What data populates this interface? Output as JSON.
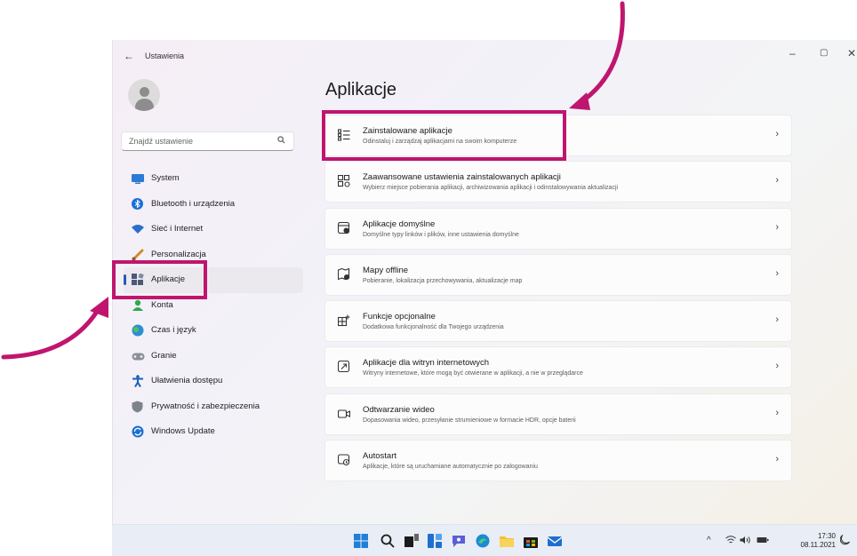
{
  "window": {
    "title": "Ustawienia",
    "back_glyph": "←",
    "controls": [
      "–",
      "▢",
      "✕"
    ]
  },
  "search": {
    "placeholder": "Znajdź ustawienie",
    "icon": "search-icon"
  },
  "sidebar": {
    "items": [
      {
        "label": "System",
        "icon": "display-icon",
        "color": "#2b7bd4"
      },
      {
        "label": "Bluetooth i urządzenia",
        "icon": "bluetooth-icon",
        "color": "#1a6fd6"
      },
      {
        "label": "Sieć i Internet",
        "icon": "wifi-icon",
        "color": "#2a6fc9"
      },
      {
        "label": "Personalizacja",
        "icon": "brush-icon",
        "color": "#d08a2e"
      },
      {
        "label": "Aplikacje",
        "icon": "apps-icon",
        "color": "#4a5a78",
        "active": true
      },
      {
        "label": "Konta",
        "icon": "account-icon",
        "color": "#2fa84f"
      },
      {
        "label": "Czas i język",
        "icon": "globe-clock-icon",
        "color": "#2a8fd4"
      },
      {
        "label": "Granie",
        "icon": "gamepad-icon",
        "color": "#8a8f98"
      },
      {
        "label": "Ułatwienia dostępu",
        "icon": "accessibility-icon",
        "color": "#1b5fb8"
      },
      {
        "label": "Prywatność i zabezpieczenia",
        "icon": "shield-icon",
        "color": "#7d828b"
      },
      {
        "label": "Windows Update",
        "icon": "update-icon",
        "color": "#1f6fd0"
      }
    ]
  },
  "main": {
    "title": "Aplikacje",
    "cards": [
      {
        "title": "Zainstalowane aplikacje",
        "desc": "Odinstaluj i zarządzaj aplikacjami na swoim komputerze",
        "icon": "list-icon"
      },
      {
        "title": "Zaawansowane ustawienia zainstalowanych aplikacji",
        "desc": "Wybierz miejsce pobierania aplikacji, archiwizowania aplikacji i odinstalowywania aktualizacji",
        "icon": "apps-settings-icon"
      },
      {
        "title": "Aplikacje domyślne",
        "desc": "Domyślne typy linków i plików, inne ustawienia domyślne",
        "icon": "default-apps-icon"
      },
      {
        "title": "Mapy offline",
        "desc": "Pobieranie, lokalizacja przechowywania, aktualizacje map",
        "icon": "map-icon"
      },
      {
        "title": "Funkcje opcjonalne",
        "desc": "Dodatkowa funkcjonalność dla Twojego urządzenia",
        "icon": "optional-features-icon"
      },
      {
        "title": "Aplikacje dla witryn internetowych",
        "desc": "Witryny internetowe, które mogą być otwierane w aplikacji, a nie w przeglądarce",
        "icon": "web-apps-icon"
      },
      {
        "title": "Odtwarzanie wideo",
        "desc": "Dopasowania wideo, przesyłanie strumieniowe w formacie HDR, opcje baterii",
        "icon": "video-icon"
      },
      {
        "title": "Autostart",
        "desc": "Aplikacje, które są uruchamiane automatycznie po zalogowaniu",
        "icon": "startup-icon"
      }
    ],
    "chevron": "›"
  },
  "taskbar": {
    "apps": [
      "start-icon",
      "search-icon",
      "task-view-icon",
      "widgets-icon",
      "chat-icon",
      "edge-icon",
      "explorer-icon",
      "store-icon",
      "mail-icon"
    ],
    "tray": [
      "^",
      "wifi",
      "volume",
      "battery"
    ],
    "time": "17:30",
    "date": "08.11.2021"
  },
  "colors": {
    "highlight": "#c0156f",
    "accent": "#2a5ab8"
  }
}
